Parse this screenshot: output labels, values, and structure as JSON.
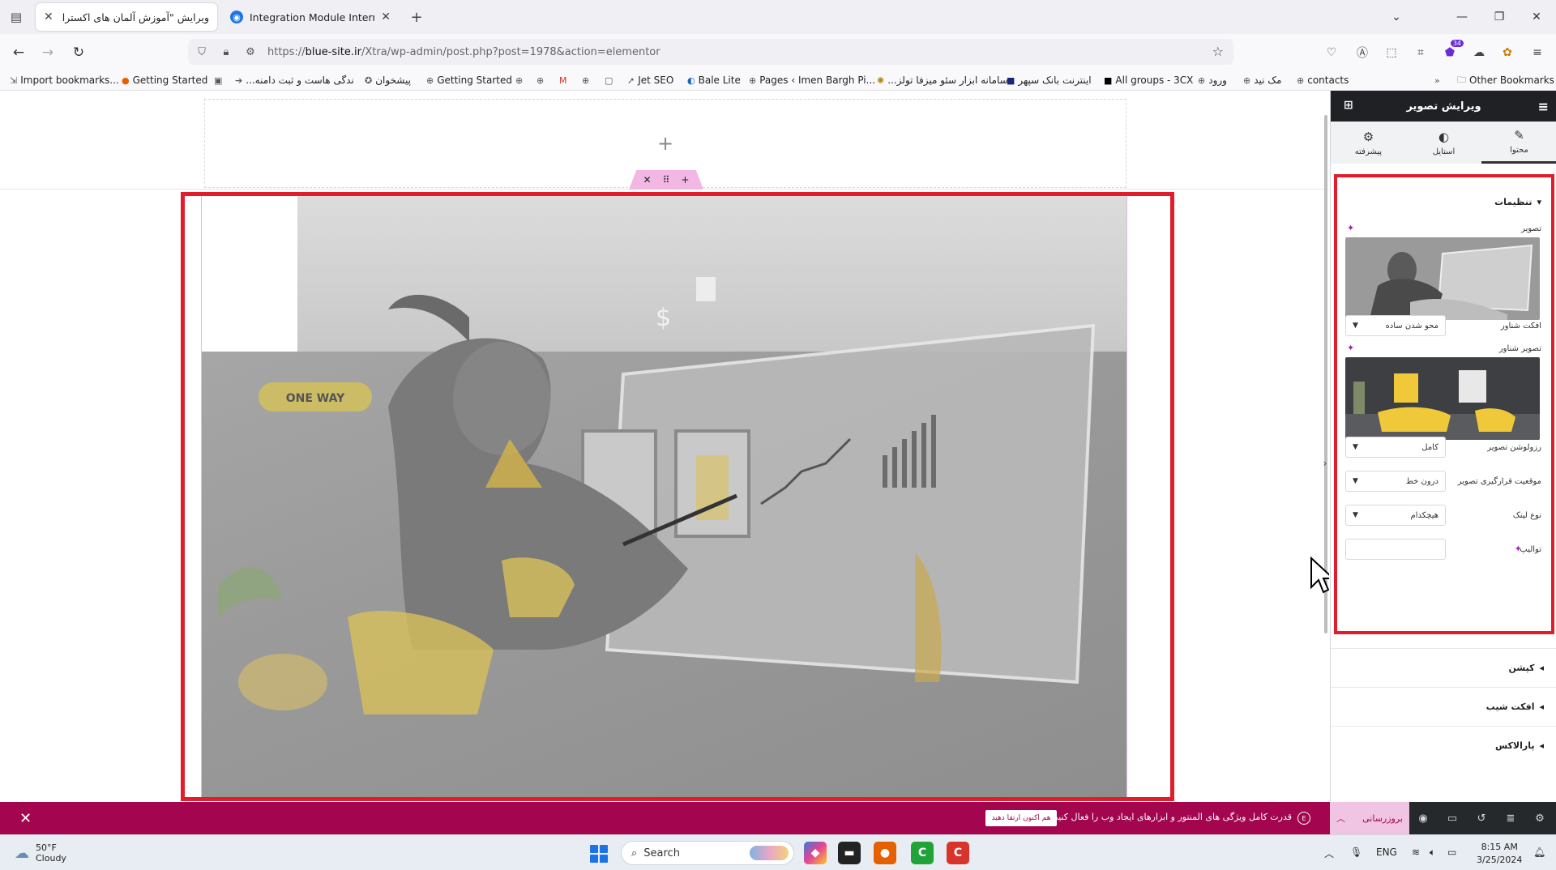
{
  "browser": {
    "tabs": [
      {
        "label": "ویرایش \"آموزش آلمان های اکسترا – ع",
        "active": true
      },
      {
        "label": "Integration Module Internet Do",
        "active": false
      }
    ],
    "url_prefix": "https://",
    "url_host": "blue-site.ir",
    "url_path": "/Xtra/wp-admin/post.php?post=1978&action=elementor",
    "extension_badge": "34",
    "bookmarks": [
      "Import bookmarks...",
      "Getting Started",
      "...ندگی هاست و ثبت دامنه",
      "پیشخوان",
      "Getting Started",
      "Jet SEO",
      "Bale Lite",
      "Pages ‹ Imen Bargh Pi...",
      "...سامانه ابزار سئو میزفا تولز",
      "اینترنت بانک سپهر",
      "All groups - 3CX",
      "ورود",
      "مک نید",
      "contacts",
      "Other Bookmarks"
    ]
  },
  "panel": {
    "title": "ویرایش تصویر",
    "tabs": [
      {
        "label": "محتوا",
        "icon": "pencil-icon"
      },
      {
        "label": "استایل",
        "icon": "contrast-icon"
      },
      {
        "label": "پیشرفته",
        "icon": "gear-icon"
      }
    ],
    "section_title": "تنظیمات",
    "fields": {
      "image_label": "تصویر",
      "hover_effect_label": "افکت شناور",
      "hover_effect_value": "محو شدن ساده",
      "hover_image_label": "تصویر شناور",
      "resolution_label": "رزولوشن تصویر",
      "resolution_value": "کامل",
      "position_label": "موقعیت قرارگیری تصویر",
      "position_value": "درون خط",
      "link_type_label": "نوع لینک",
      "link_type_value": "هیچکدام",
      "caption_label": "توالیپ"
    },
    "accordions": [
      "کپشن",
      "افکت شیب",
      "پارالاکس"
    ]
  },
  "canvas": {
    "image_text": "ONE WAY"
  },
  "promo": {
    "text": "قدرت کامل ویژگی های المنتور و ابزارهای ایجاد وب را فعال کنید.",
    "button": "هم اکنون ارتقا دهید",
    "update_button": "بروزرسانی"
  },
  "taskbar": {
    "weather_temp": "50°F",
    "weather_desc": "Cloudy",
    "search_placeholder": "Search",
    "language": "ENG",
    "time": "8:15 AM",
    "date": "3/25/2024"
  },
  "colors": {
    "accent_red": "#e11d2b",
    "elementor_pink": "#a3064e",
    "panel_dark": "#1f2124"
  }
}
